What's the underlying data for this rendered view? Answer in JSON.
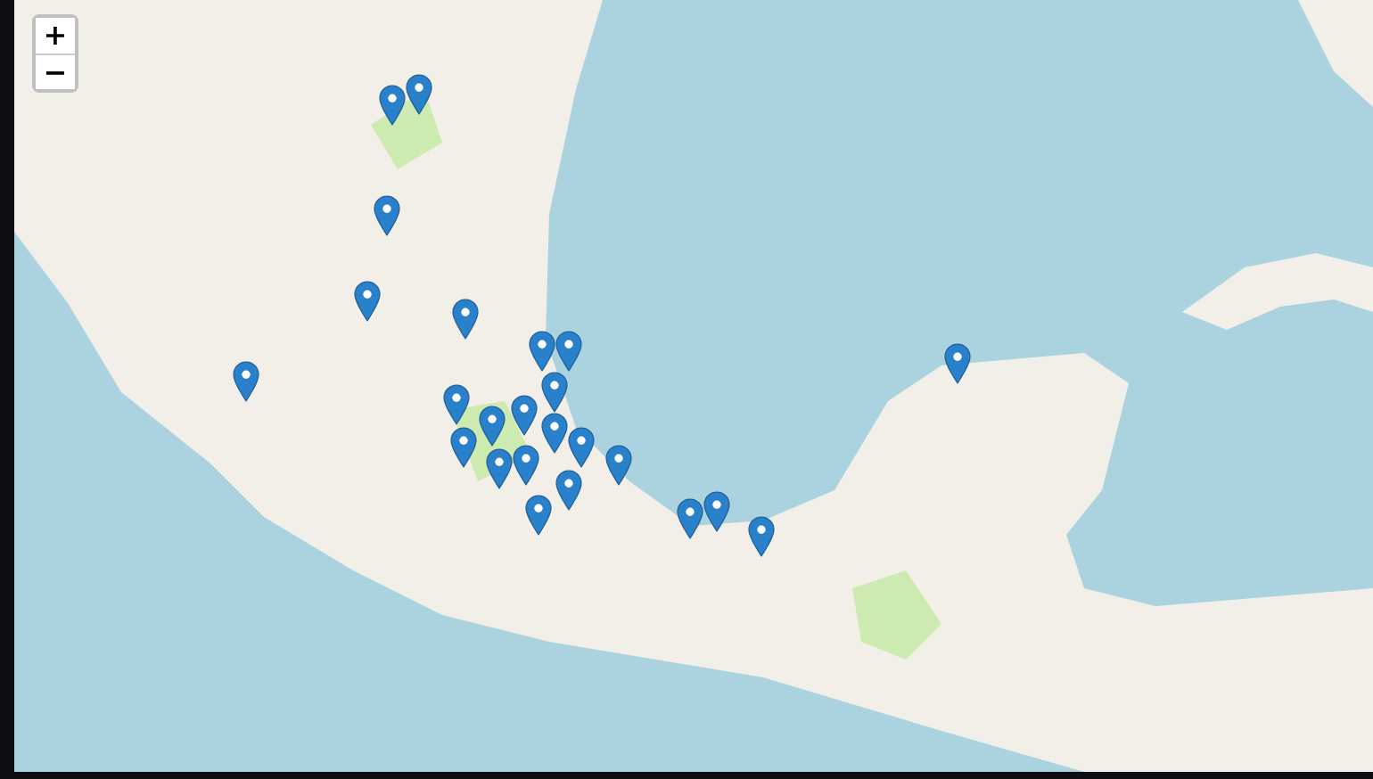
{
  "zoom_controls": [
    {
      "label": "+"
    },
    {
      "label": "−"
    }
  ]
}
